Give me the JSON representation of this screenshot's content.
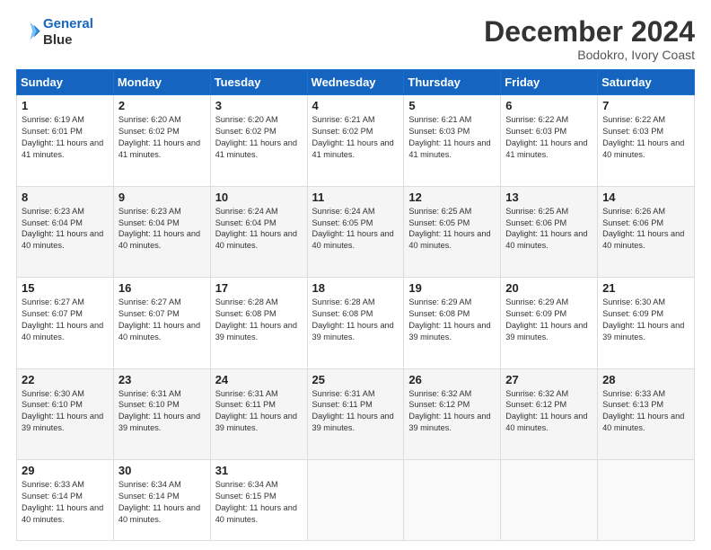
{
  "header": {
    "logo_line1": "General",
    "logo_line2": "Blue",
    "month": "December 2024",
    "location": "Bodokro, Ivory Coast"
  },
  "days_of_week": [
    "Sunday",
    "Monday",
    "Tuesday",
    "Wednesday",
    "Thursday",
    "Friday",
    "Saturday"
  ],
  "weeks": [
    [
      {
        "num": "1",
        "rise": "6:19 AM",
        "set": "6:01 PM",
        "hours": "11 hours and 41 minutes."
      },
      {
        "num": "2",
        "rise": "6:20 AM",
        "set": "6:02 PM",
        "hours": "11 hours and 41 minutes."
      },
      {
        "num": "3",
        "rise": "6:20 AM",
        "set": "6:02 PM",
        "hours": "11 hours and 41 minutes."
      },
      {
        "num": "4",
        "rise": "6:21 AM",
        "set": "6:02 PM",
        "hours": "11 hours and 41 minutes."
      },
      {
        "num": "5",
        "rise": "6:21 AM",
        "set": "6:03 PM",
        "hours": "11 hours and 41 minutes."
      },
      {
        "num": "6",
        "rise": "6:22 AM",
        "set": "6:03 PM",
        "hours": "11 hours and 41 minutes."
      },
      {
        "num": "7",
        "rise": "6:22 AM",
        "set": "6:03 PM",
        "hours": "11 hours and 40 minutes."
      }
    ],
    [
      {
        "num": "8",
        "rise": "6:23 AM",
        "set": "6:04 PM",
        "hours": "11 hours and 40 minutes."
      },
      {
        "num": "9",
        "rise": "6:23 AM",
        "set": "6:04 PM",
        "hours": "11 hours and 40 minutes."
      },
      {
        "num": "10",
        "rise": "6:24 AM",
        "set": "6:04 PM",
        "hours": "11 hours and 40 minutes."
      },
      {
        "num": "11",
        "rise": "6:24 AM",
        "set": "6:05 PM",
        "hours": "11 hours and 40 minutes."
      },
      {
        "num": "12",
        "rise": "6:25 AM",
        "set": "6:05 PM",
        "hours": "11 hours and 40 minutes."
      },
      {
        "num": "13",
        "rise": "6:25 AM",
        "set": "6:06 PM",
        "hours": "11 hours and 40 minutes."
      },
      {
        "num": "14",
        "rise": "6:26 AM",
        "set": "6:06 PM",
        "hours": "11 hours and 40 minutes."
      }
    ],
    [
      {
        "num": "15",
        "rise": "6:27 AM",
        "set": "6:07 PM",
        "hours": "11 hours and 40 minutes."
      },
      {
        "num": "16",
        "rise": "6:27 AM",
        "set": "6:07 PM",
        "hours": "11 hours and 40 minutes."
      },
      {
        "num": "17",
        "rise": "6:28 AM",
        "set": "6:08 PM",
        "hours": "11 hours and 39 minutes."
      },
      {
        "num": "18",
        "rise": "6:28 AM",
        "set": "6:08 PM",
        "hours": "11 hours and 39 minutes."
      },
      {
        "num": "19",
        "rise": "6:29 AM",
        "set": "6:08 PM",
        "hours": "11 hours and 39 minutes."
      },
      {
        "num": "20",
        "rise": "6:29 AM",
        "set": "6:09 PM",
        "hours": "11 hours and 39 minutes."
      },
      {
        "num": "21",
        "rise": "6:30 AM",
        "set": "6:09 PM",
        "hours": "11 hours and 39 minutes."
      }
    ],
    [
      {
        "num": "22",
        "rise": "6:30 AM",
        "set": "6:10 PM",
        "hours": "11 hours and 39 minutes."
      },
      {
        "num": "23",
        "rise": "6:31 AM",
        "set": "6:10 PM",
        "hours": "11 hours and 39 minutes."
      },
      {
        "num": "24",
        "rise": "6:31 AM",
        "set": "6:11 PM",
        "hours": "11 hours and 39 minutes."
      },
      {
        "num": "25",
        "rise": "6:31 AM",
        "set": "6:11 PM",
        "hours": "11 hours and 39 minutes."
      },
      {
        "num": "26",
        "rise": "6:32 AM",
        "set": "6:12 PM",
        "hours": "11 hours and 39 minutes."
      },
      {
        "num": "27",
        "rise": "6:32 AM",
        "set": "6:12 PM",
        "hours": "11 hours and 40 minutes."
      },
      {
        "num": "28",
        "rise": "6:33 AM",
        "set": "6:13 PM",
        "hours": "11 hours and 40 minutes."
      }
    ],
    [
      {
        "num": "29",
        "rise": "6:33 AM",
        "set": "6:14 PM",
        "hours": "11 hours and 40 minutes."
      },
      {
        "num": "30",
        "rise": "6:34 AM",
        "set": "6:14 PM",
        "hours": "11 hours and 40 minutes."
      },
      {
        "num": "31",
        "rise": "6:34 AM",
        "set": "6:15 PM",
        "hours": "11 hours and 40 minutes."
      },
      null,
      null,
      null,
      null
    ]
  ]
}
